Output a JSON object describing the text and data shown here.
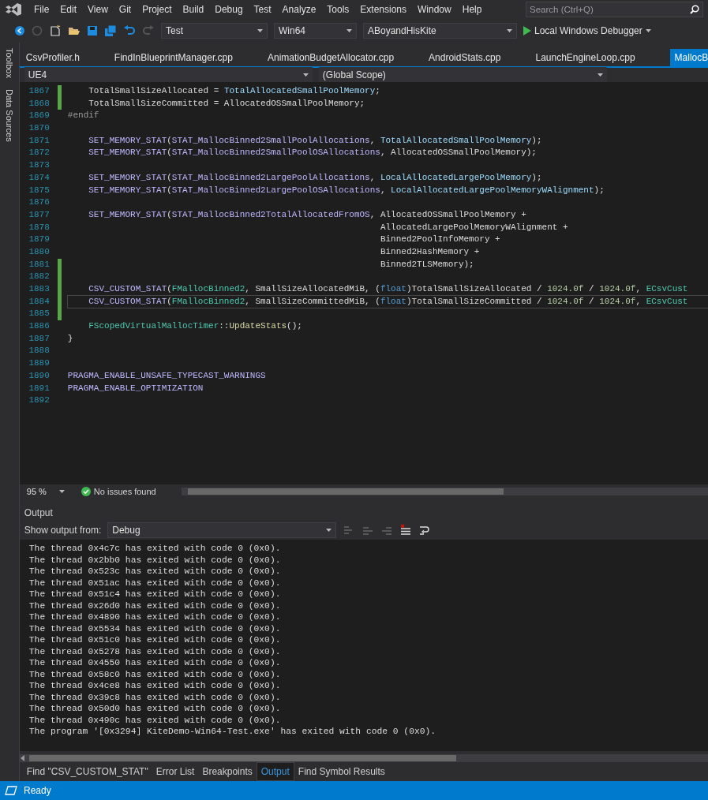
{
  "menu": [
    "File",
    "Edit",
    "View",
    "Git",
    "Project",
    "Build",
    "Debug",
    "Test",
    "Analyze",
    "Tools",
    "Extensions",
    "Window",
    "Help"
  ],
  "search": {
    "placeholder": "Search (Ctrl+Q)"
  },
  "toolbar": {
    "configuration": "Test",
    "platform": "Win64",
    "project": "ABoyandHisKite",
    "debugger": "Local Windows Debugger"
  },
  "side_tabs": [
    "Toolbox",
    "Data Sources"
  ],
  "file_tabs": [
    {
      "label": "CsvProfiler.h",
      "selected": false
    },
    {
      "label": "FindInBlueprintManager.cpp",
      "selected": false
    },
    {
      "label": "AnimationBudgetAllocator.cpp",
      "selected": false
    },
    {
      "label": "AndroidStats.cpp",
      "selected": false
    },
    {
      "label": "LaunchEngineLoop.cpp",
      "selected": false
    },
    {
      "label": "MallocB",
      "selected": true
    }
  ],
  "navigation": {
    "project": "UE4",
    "scope": "(Global Scope)"
  },
  "code_lines": [
    {
      "number": "1867",
      "changed": true,
      "current": false,
      "tokens": [
        {
          "kind": "plain",
          "text": "    TotalSmallSizeAllocated = "
        },
        {
          "kind": "var",
          "text": "TotalAllocatedSmallPoolMemory"
        },
        {
          "kind": "plain",
          "text": ";"
        }
      ]
    },
    {
      "number": "1868",
      "changed": true,
      "current": false,
      "tokens": [
        {
          "kind": "plain",
          "text": "    TotalSmallSizeCommitted = AllocatedOSSmallPoolMemory;"
        }
      ]
    },
    {
      "number": "1869",
      "changed": false,
      "current": false,
      "tokens": [
        {
          "kind": "preproc",
          "text": "#endif"
        }
      ]
    },
    {
      "number": "1870",
      "changed": false,
      "current": false
    },
    {
      "number": "1871",
      "changed": false,
      "current": false,
      "tokens": [
        {
          "kind": "macro",
          "text": "    SET_MEMORY_STAT"
        },
        {
          "kind": "plain",
          "text": "("
        },
        {
          "kind": "macro",
          "text": "STAT_MallocBinned2SmallPoolAllocations"
        },
        {
          "kind": "plain",
          "text": ", "
        },
        {
          "kind": "var",
          "text": "TotalAllocatedSmallPoolMemory"
        },
        {
          "kind": "plain",
          "text": ");"
        }
      ]
    },
    {
      "number": "1872",
      "changed": false,
      "current": false,
      "tokens": [
        {
          "kind": "macro",
          "text": "    SET_MEMORY_STAT"
        },
        {
          "kind": "plain",
          "text": "("
        },
        {
          "kind": "macro",
          "text": "STAT_MallocBinned2SmallPoolOSAllocations"
        },
        {
          "kind": "plain",
          "text": ", AllocatedOSSmallPoolMemory);"
        }
      ]
    },
    {
      "number": "1873",
      "changed": false,
      "current": false
    },
    {
      "number": "1874",
      "changed": false,
      "current": false,
      "tokens": [
        {
          "kind": "macro",
          "text": "    SET_MEMORY_STAT"
        },
        {
          "kind": "plain",
          "text": "("
        },
        {
          "kind": "macro",
          "text": "STAT_MallocBinned2LargePoolAllocations"
        },
        {
          "kind": "plain",
          "text": ", "
        },
        {
          "kind": "var",
          "text": "LocalAllocatedLargePoolMemory"
        },
        {
          "kind": "plain",
          "text": ");"
        }
      ]
    },
    {
      "number": "1875",
      "changed": false,
      "current": false,
      "tokens": [
        {
          "kind": "macro",
          "text": "    SET_MEMORY_STAT"
        },
        {
          "kind": "plain",
          "text": "("
        },
        {
          "kind": "macro",
          "text": "STAT_MallocBinned2LargePoolOSAllocations"
        },
        {
          "kind": "plain",
          "text": ", "
        },
        {
          "kind": "var",
          "text": "LocalAllocatedLargePoolMemoryWAlignment"
        },
        {
          "kind": "plain",
          "text": ");"
        }
      ]
    },
    {
      "number": "1876",
      "changed": false,
      "current": false
    },
    {
      "number": "1877",
      "changed": false,
      "current": false,
      "tokens": [
        {
          "kind": "macro",
          "text": "    SET_MEMORY_STAT"
        },
        {
          "kind": "plain",
          "text": "("
        },
        {
          "kind": "macro",
          "text": "STAT_MallocBinned2TotalAllocatedFromOS"
        },
        {
          "kind": "plain",
          "text": ", AllocatedOSSmallPoolMemory +"
        }
      ]
    },
    {
      "number": "1878",
      "changed": false,
      "current": false,
      "tokens": [
        {
          "kind": "plain",
          "text": "                                                            AllocatedLargePoolMemoryWAlignment +"
        }
      ]
    },
    {
      "number": "1879",
      "changed": false,
      "current": false,
      "tokens": [
        {
          "kind": "plain",
          "text": "                                                            Binned2PoolInfoMemory +"
        }
      ]
    },
    {
      "number": "1880",
      "changed": false,
      "current": false,
      "tokens": [
        {
          "kind": "plain",
          "text": "                                                            Binned2HashMemory +"
        }
      ]
    },
    {
      "number": "1881",
      "changed": true,
      "current": false,
      "tokens": [
        {
          "kind": "plain",
          "text": "                                                            Binned2TLSMemory);"
        }
      ]
    },
    {
      "number": "1882",
      "changed": true,
      "current": false
    },
    {
      "number": "1883",
      "changed": true,
      "current": false,
      "tokens": [
        {
          "kind": "macro",
          "text": "    CSV_CUSTOM_STAT"
        },
        {
          "kind": "plain",
          "text": "("
        },
        {
          "kind": "type",
          "text": "FMallocBinned2"
        },
        {
          "kind": "plain",
          "text": ", SmallSizeAllocatedMiB, ("
        },
        {
          "kind": "keyword",
          "text": "float"
        },
        {
          "kind": "plain",
          "text": ")TotalSmallSizeAllocated / "
        },
        {
          "kind": "number",
          "text": "1024.0f"
        },
        {
          "kind": "plain",
          "text": " / "
        },
        {
          "kind": "number",
          "text": "1024.0f"
        },
        {
          "kind": "plain",
          "text": ", "
        },
        {
          "kind": "type",
          "text": "ECsvCust"
        }
      ]
    },
    {
      "number": "1884",
      "changed": true,
      "current": true,
      "tokens": [
        {
          "kind": "macro",
          "text": "    CSV_CUSTOM_STAT"
        },
        {
          "kind": "plain",
          "text": "("
        },
        {
          "kind": "type",
          "text": "FMallocBinned2"
        },
        {
          "kind": "plain",
          "text": ", SmallSizeCommittedMiB, ("
        },
        {
          "kind": "keyword",
          "text": "float"
        },
        {
          "kind": "plain",
          "text": ")TotalSmallSizeCommitted / "
        },
        {
          "kind": "number",
          "text": "1024.0f"
        },
        {
          "kind": "plain",
          "text": " / "
        },
        {
          "kind": "number",
          "text": "1024.0f"
        },
        {
          "kind": "plain",
          "text": ", "
        },
        {
          "kind": "type",
          "text": "ECsvCust"
        }
      ]
    },
    {
      "number": "1885",
      "changed": true,
      "current": false
    },
    {
      "number": "1886",
      "changed": false,
      "current": false,
      "tokens": [
        {
          "kind": "type",
          "text": "    FScopedVirtualMallocTimer"
        },
        {
          "kind": "plain",
          "text": "::"
        },
        {
          "kind": "function",
          "text": "UpdateStats"
        },
        {
          "kind": "plain",
          "text": "();"
        }
      ]
    },
    {
      "number": "1887",
      "changed": false,
      "current": false,
      "tokens": [
        {
          "kind": "plain",
          "text": "}"
        }
      ]
    },
    {
      "number": "1888",
      "changed": false,
      "current": false
    },
    {
      "number": "1889",
      "changed": false,
      "current": false
    },
    {
      "number": "1890",
      "changed": false,
      "current": false,
      "tokens": [
        {
          "kind": "macro",
          "text": "PRAGMA_ENABLE_UNSAFE_TYPECAST_WARNINGS"
        }
      ]
    },
    {
      "number": "1891",
      "changed": false,
      "current": false,
      "tokens": [
        {
          "kind": "macro",
          "text": "PRAGMA_ENABLE_OPTIMIZATION"
        }
      ]
    },
    {
      "number": "1892",
      "changed": false,
      "current": false
    }
  ],
  "editor_status": {
    "zoom": "95 %",
    "issues": "No issues found"
  },
  "output": {
    "title": "Output",
    "source_label": "Show output from:",
    "source": "Debug",
    "lines": [
      "The thread 0x4c7c has exited with code 0 (0x0).",
      "The thread 0x2bb0 has exited with code 0 (0x0).",
      "The thread 0x523c has exited with code 0 (0x0).",
      "The thread 0x51ac has exited with code 0 (0x0).",
      "The thread 0x51c4 has exited with code 0 (0x0).",
      "The thread 0x26d0 has exited with code 0 (0x0).",
      "The thread 0x4890 has exited with code 0 (0x0).",
      "The thread 0x5534 has exited with code 0 (0x0).",
      "The thread 0x51c0 has exited with code 0 (0x0).",
      "The thread 0x5278 has exited with code 0 (0x0).",
      "The thread 0x4550 has exited with code 0 (0x0).",
      "The thread 0x58c0 has exited with code 0 (0x0).",
      "The thread 0x4ce8 has exited with code 0 (0x0).",
      "The thread 0x39c8 has exited with code 0 (0x0).",
      "The thread 0x50d0 has exited with code 0 (0x0).",
      "The thread 0x490c has exited with code 0 (0x0).",
      "The program '[0x3294] KiteDemo-Win64-Test.exe' has exited with code 0 (0x0)."
    ]
  },
  "bottom_tabs": [
    {
      "label": "Find \"CSV_CUSTOM_STAT\"",
      "selected": false
    },
    {
      "label": "Error List",
      "selected": false
    },
    {
      "label": "Breakpoints",
      "selected": false
    },
    {
      "label": "Output",
      "selected": true
    },
    {
      "label": "Find Symbol Results",
      "selected": false
    }
  ],
  "status_bar": {
    "text": "Ready"
  }
}
